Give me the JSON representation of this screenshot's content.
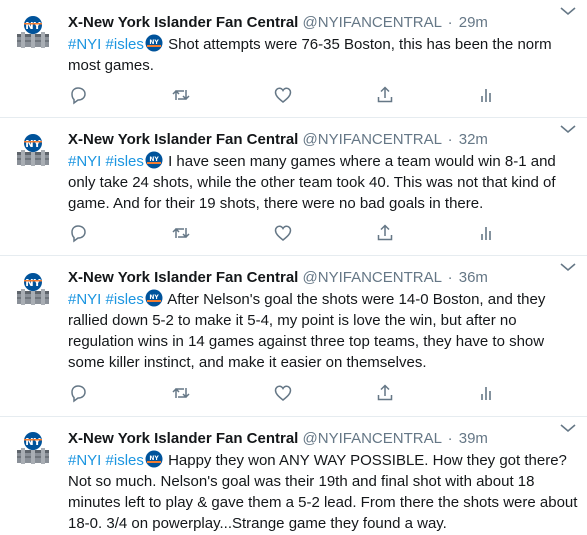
{
  "tweets": [
    {
      "name": "X-New York Islander Fan Central",
      "handle": "@NYIFANCENTRAL",
      "separator": "·",
      "time": "29m",
      "hashtag1": "#NYI",
      "hashtag2": "#isles",
      "body": "Shot attempts were 76-35 Boston, this has been the norm most games."
    },
    {
      "name": "X-New York Islander Fan Central",
      "handle": "@NYIFANCENTRAL",
      "separator": "·",
      "time": "32m",
      "hashtag1": "#NYI",
      "hashtag2": "#isles",
      "body": "I have seen many games where a team would win 8-1 and only take 24 shots, while the other team took 40. This was not that kind of game. And for their 19 shots, there were no bad goals in there."
    },
    {
      "name": "X-New York Islander Fan Central",
      "handle": "@NYIFANCENTRAL",
      "separator": "·",
      "time": "36m",
      "hashtag1": "#NYI",
      "hashtag2": "#isles",
      "body": "After Nelson's goal the shots were 14-0 Boston, and they rallied down 5-2 to make it 5-4, my point is love the win, but after no regulation wins in 14 games against three top teams, they have to show some killer instinct, and make it easier on themselves."
    },
    {
      "name": "X-New York Islander Fan Central",
      "handle": "@NYIFANCENTRAL",
      "separator": "·",
      "time": "39m",
      "hashtag1": "#NYI",
      "hashtag2": "#isles",
      "body": "Happy they won ANY WAY POSSIBLE. How they got there? Not so much. Nelson's goal was their 19th and final shot with about 18 minutes left to play & gave them a 5-2 lead. From there the shots were about 18-0. 3/4 on powerplay...Strange game they found a way."
    }
  ],
  "icons": {
    "avatar": "islanders-logo",
    "hashtag_emoji": "islanders-emoji",
    "more": "chevron-down-icon",
    "actions": [
      "reply-icon",
      "retweet-icon",
      "like-icon",
      "share-icon",
      "analytics-icon"
    ]
  },
  "colors": {
    "text": "#14171a",
    "secondary": "#657786",
    "link": "#1b95e0",
    "divider": "#e6ecf0",
    "islanders_blue": "#00539b",
    "islanders_orange": "#f47d30"
  }
}
